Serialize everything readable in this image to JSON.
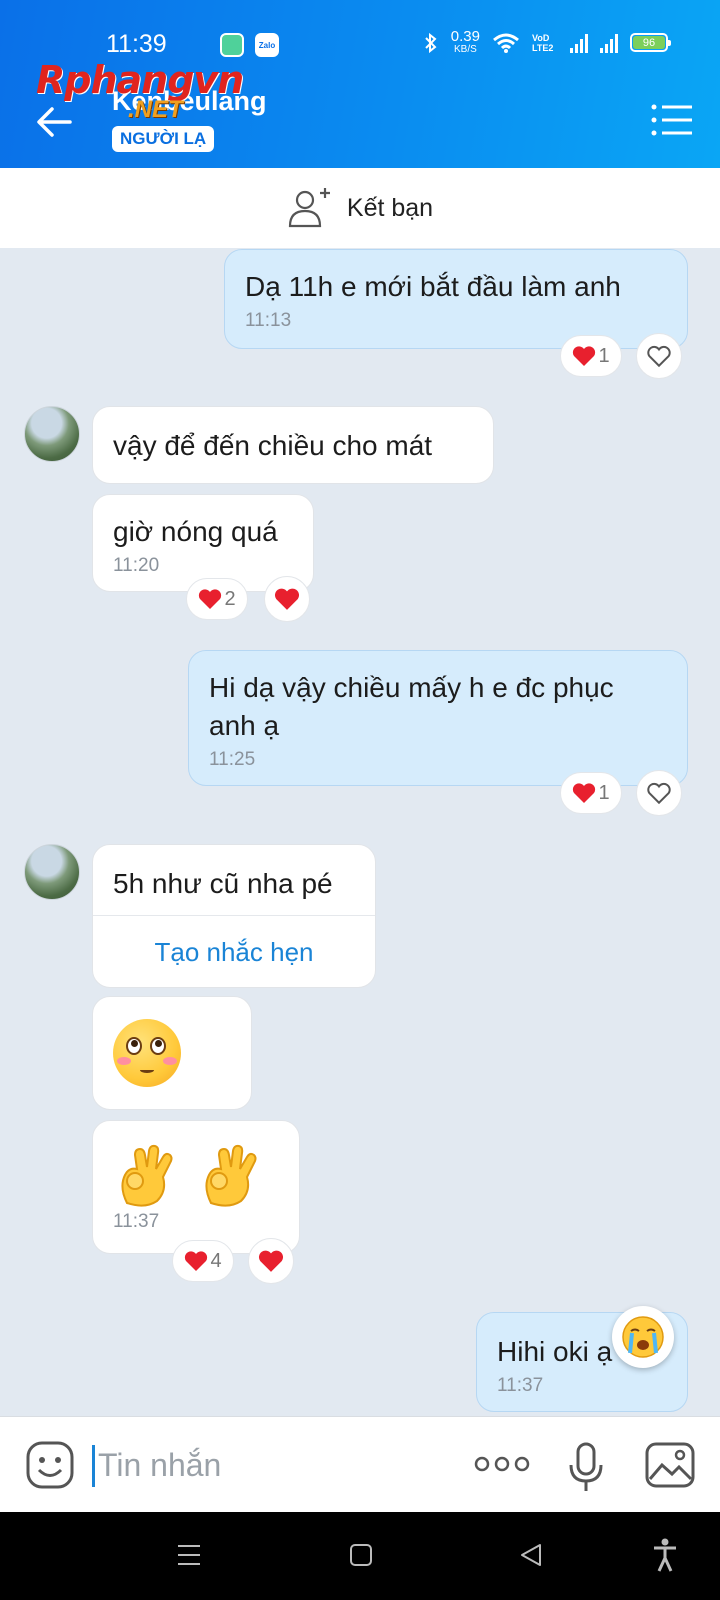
{
  "status_bar": {
    "time": "11:39",
    "net_speed_value": "0.39",
    "net_speed_unit": "KB/S",
    "vowifi": "VoD LTE2",
    "battery": "96",
    "app_icons": [
      "chat-app-icon",
      "zalo-icon"
    ],
    "zalo_label": "Zalo"
  },
  "header": {
    "contact_name": "Kenbeulang",
    "badge": "NGƯỜI LẠ",
    "watermark_main": "Rphangvn",
    "watermark_sub": ".NET",
    "accent": "#0a7ee8"
  },
  "add_friend": {
    "label": "Kết bạn",
    "icon": "add-user-icon"
  },
  "messages": [
    {
      "direction": "out",
      "text": "Dạ 11h e mới bắt đầu làm anh",
      "time": "11:13",
      "reactions": {
        "count": "1",
        "emoji": "heart"
      }
    },
    {
      "direction": "in",
      "text": "vậy để đến chiều cho mát"
    },
    {
      "direction": "in",
      "text": "giờ nóng quá",
      "time": "11:20",
      "reactions": {
        "count": "2",
        "emoji": "heart"
      }
    },
    {
      "direction": "out",
      "text": "Hi dạ vậy chiều mấy h e đc phục anh ạ",
      "time": "11:25",
      "reactions": {
        "count": "1",
        "emoji": "heart"
      }
    },
    {
      "direction": "in",
      "text": "5h như cũ nha pé",
      "action": "Tạo nhắc hẹn"
    },
    {
      "direction": "in",
      "emoji": "rolling-eyes-smile"
    },
    {
      "direction": "in",
      "emoji": "ok-hands",
      "time": "11:37",
      "reactions": {
        "count": "4",
        "emoji": "heart"
      }
    },
    {
      "direction": "out",
      "text": "Hihi oki ạ",
      "time": "11:37"
    }
  ],
  "composer": {
    "placeholder": "Tin nhắn"
  }
}
